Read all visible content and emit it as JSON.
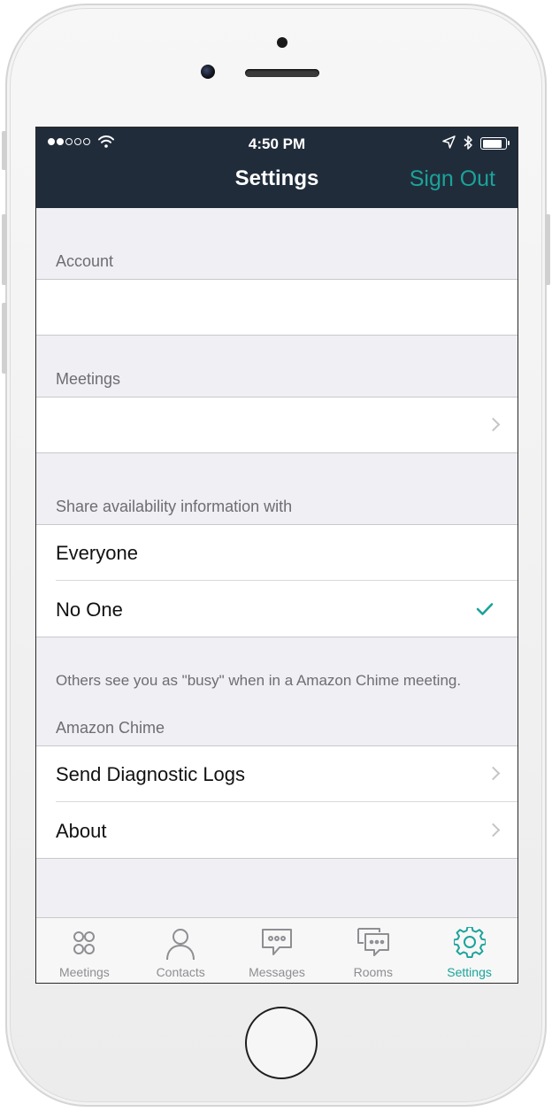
{
  "status_bar": {
    "time": "4:50 PM"
  },
  "nav": {
    "title": "Settings",
    "sign_out_label": "Sign Out"
  },
  "sections": {
    "account_header": "Account",
    "meetings_header": "Meetings",
    "availability_header": "Share availability information with",
    "availability_options": [
      "Everyone",
      "No One"
    ],
    "availability_selected": "No One",
    "availability_note": "Others see you as \"busy\" when in a Amazon Chime meeting.",
    "chime_header": "Amazon Chime",
    "chime_items": [
      "Send Diagnostic Logs",
      "About"
    ]
  },
  "tabs": [
    {
      "label": "Meetings",
      "icon": "meetings-icon"
    },
    {
      "label": "Contacts",
      "icon": "contacts-icon"
    },
    {
      "label": "Messages",
      "icon": "messages-icon"
    },
    {
      "label": "Rooms",
      "icon": "rooms-icon"
    },
    {
      "label": "Settings",
      "icon": "gear-icon"
    }
  ],
  "active_tab": "Settings",
  "colors": {
    "accent": "#1aa39a",
    "navbar": "#212c3b",
    "background": "#efeff4"
  }
}
